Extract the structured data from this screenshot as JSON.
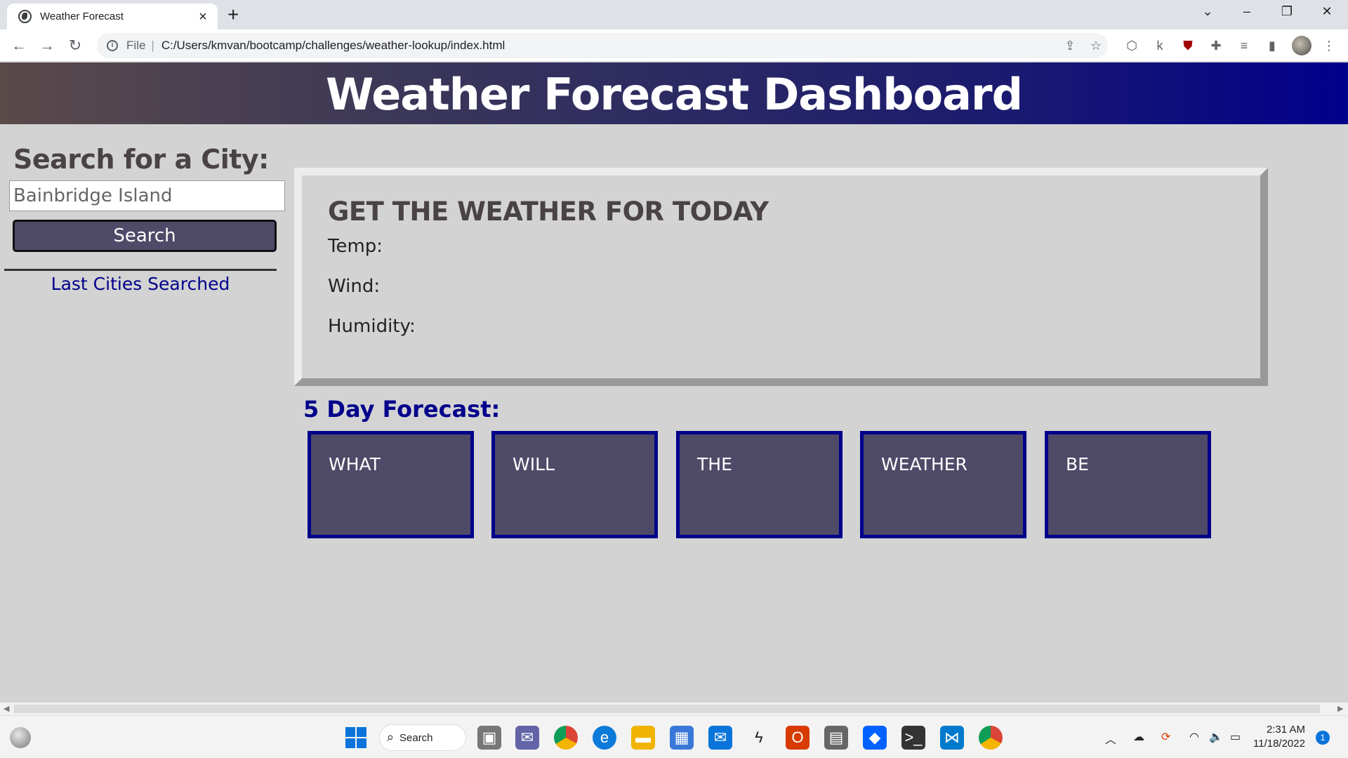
{
  "browser": {
    "tab_title": "Weather Forecast",
    "url_scheme": "File",
    "url": "C:/Users/kmvan/bootcamp/challenges/weather-lookup/index.html"
  },
  "page": {
    "header_title": "Weather Forecast Dashboard",
    "sidebar": {
      "title": "Search for a City:",
      "input_value": "Bainbridge Island",
      "search_label": "Search",
      "history_title": "Last Cities Searched"
    },
    "today": {
      "title": "GET THE WEATHER FOR TODAY",
      "temp_label": "Temp:",
      "wind_label": "Wind:",
      "humidity_label": "Humidity:"
    },
    "forecast": {
      "title": "5 Day Forecast:",
      "cards": [
        "WHAT",
        "WILL",
        "THE",
        "WEATHER",
        "BE"
      ]
    }
  },
  "taskbar": {
    "search_label": "Search",
    "time": "2:31 AM",
    "date": "11/18/2022",
    "notification_count": "1"
  },
  "colors": {
    "header_gradient_end": "#00008b",
    "accent_navy": "#00008b",
    "card_fill": "#4e4a68",
    "page_bg": "#d3d3d3"
  }
}
